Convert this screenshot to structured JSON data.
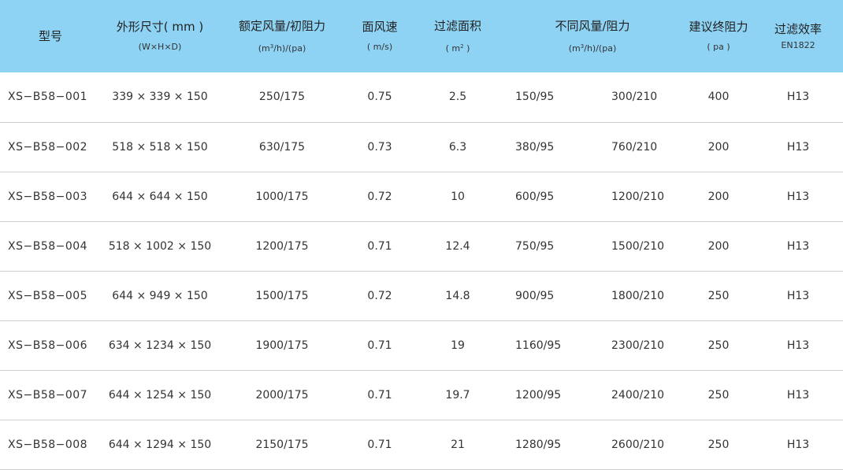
{
  "header": {
    "model": "型号",
    "size": {
      "title": "外形尺寸( mm )",
      "unit": "(W×H×D)"
    },
    "rated": {
      "title": "额定风量/初阻力",
      "unit_pre": "(m",
      "unit_sup": "3",
      "unit_post": "/h)/(pa)"
    },
    "velocity": {
      "title": "面风速",
      "unit": "( m/s)"
    },
    "area": {
      "title": "过滤面积",
      "unit_pre": "( m",
      "unit_sup": "2",
      "unit_post": " )"
    },
    "flows": {
      "title": "不同风量/阻力",
      "unit_pre": "(m",
      "unit_sup": "3",
      "unit_post": "/h)/(pa)"
    },
    "final": {
      "title": "建议终阻力",
      "unit": "( pa )"
    },
    "efficiency": {
      "title": "过滤效率",
      "unit": "EN1822"
    }
  },
  "rows": [
    {
      "model": "XS−B58−001",
      "size": "339 × 339 × 150",
      "rated": "250/175",
      "velocity": "0.75",
      "area": "2.5",
      "flow_a": "150/95",
      "flow_b": "300/210",
      "final": "400",
      "eff": "H13"
    },
    {
      "model": "XS−B58−002",
      "size": "518 × 518 × 150",
      "rated": "630/175",
      "velocity": "0.73",
      "area": "6.3",
      "flow_a": "380/95",
      "flow_b": "760/210",
      "final": "200",
      "eff": "H13"
    },
    {
      "model": "XS−B58−003",
      "size": "644 × 644 × 150",
      "rated": "1000/175",
      "velocity": "0.72",
      "area": "10",
      "flow_a": "600/95",
      "flow_b": "1200/210",
      "final": "200",
      "eff": "H13"
    },
    {
      "model": "XS−B58−004",
      "size": "518 × 1002 × 150",
      "rated": "1200/175",
      "velocity": "0.71",
      "area": "12.4",
      "flow_a": "750/95",
      "flow_b": "1500/210",
      "final": "200",
      "eff": "H13"
    },
    {
      "model": "XS−B58−005",
      "size": "644 × 949 × 150",
      "rated": "1500/175",
      "velocity": "0.72",
      "area": "14.8",
      "flow_a": "900/95",
      "flow_b": "1800/210",
      "final": "250",
      "eff": "H13"
    },
    {
      "model": "XS−B58−006",
      "size": "634 × 1234 × 150",
      "rated": "1900/175",
      "velocity": "0.71",
      "area": "19",
      "flow_a": "1160/95",
      "flow_b": "2300/210",
      "final": "250",
      "eff": "H13"
    },
    {
      "model": "XS−B58−007",
      "size": "644 × 1254 × 150",
      "rated": "2000/175",
      "velocity": "0.71",
      "area": "19.7",
      "flow_a": "1200/95",
      "flow_b": "2400/210",
      "final": "250",
      "eff": "H13"
    },
    {
      "model": "XS−B58−008",
      "size": "644 × 1294 × 150",
      "rated": "2150/175",
      "velocity": "0.71",
      "area": "21",
      "flow_a": "1280/95",
      "flow_b": "2600/210",
      "final": "250",
      "eff": "H13"
    }
  ]
}
